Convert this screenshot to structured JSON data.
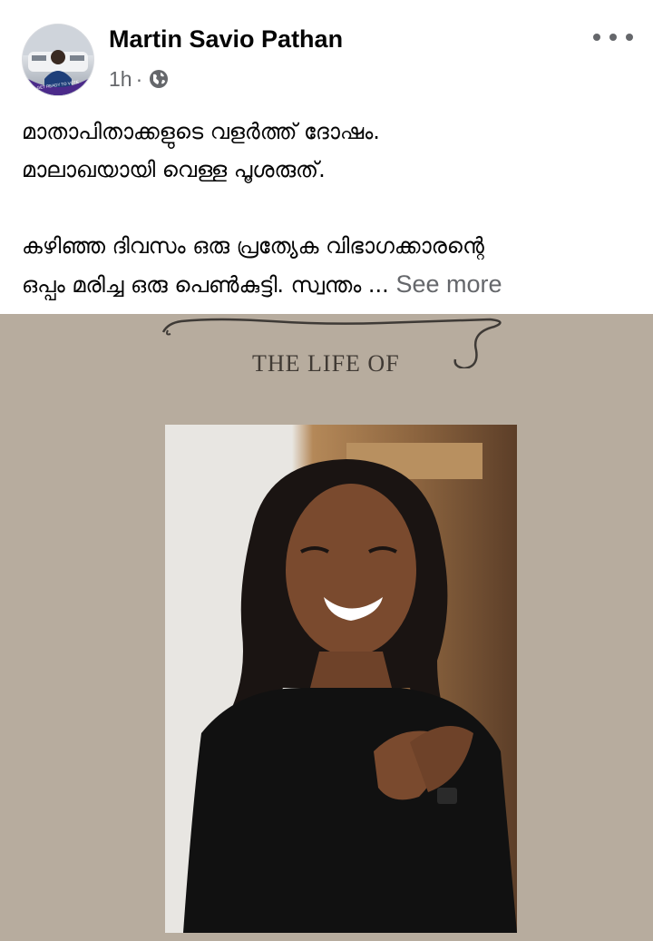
{
  "post": {
    "author": "Martin Savio Pathan",
    "time": "1h",
    "separator": "·",
    "avatar_badge": "GET READY TO VOTE",
    "text_lines": [
      "മാതാപിതാക്കളുടെ വളർത്ത് ദോഷം.",
      "മാലാഖയായി വെള്ള പൂശരുത്."
    ],
    "text_lines_2": [
      "കഴിഞ്ഞ ദിവസം  ഒരു പ്രത്യേക വിഭാഗക്കാരന്റെ",
      "ഒപ്പം മരിച്ച  ഒരു പെൺകുട്ടി. സ്വന്തം ..."
    ],
    "see_more": "See more",
    "privacy_icon": "globe-icon",
    "options_icon": "more-horizontal-icon"
  },
  "photo": {
    "label": "THE LIFE OF",
    "colors": {
      "background": "#b7ac9e",
      "text": "#403a34"
    }
  },
  "colors": {
    "primary_text": "#050505",
    "secondary_text": "#65676b",
    "background": "#ffffff"
  }
}
